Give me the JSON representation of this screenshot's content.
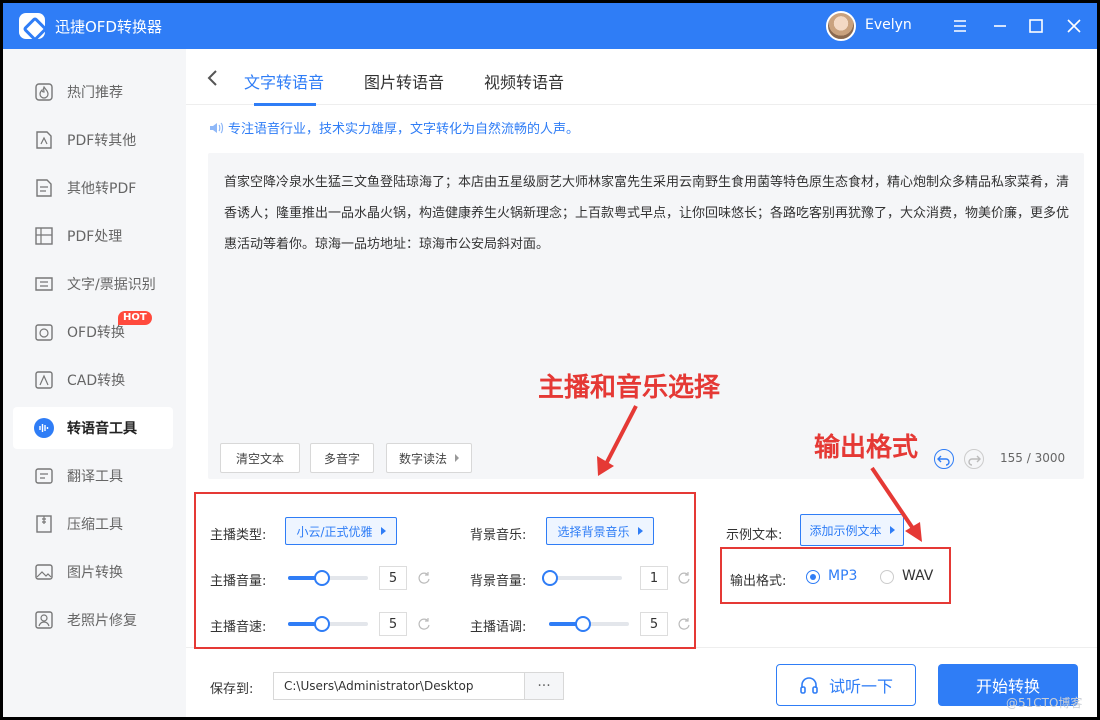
{
  "app": {
    "title": "迅捷OFD转换器",
    "username": "Evelyn"
  },
  "sidebar": {
    "items": [
      {
        "label": "热门推荐",
        "icon": "hot-recommend-icon"
      },
      {
        "label": "PDF转其他",
        "icon": "pdf-convert-icon"
      },
      {
        "label": "其他转PDF",
        "icon": "to-pdf-icon"
      },
      {
        "label": "PDF处理",
        "icon": "pdf-process-icon"
      },
      {
        "label": "文字/票据识别",
        "icon": "ocr-icon"
      },
      {
        "label": "OFD转换",
        "icon": "ofd-icon",
        "badge": "HOT"
      },
      {
        "label": "CAD转换",
        "icon": "cad-icon"
      },
      {
        "label": "转语音工具",
        "icon": "voice-icon",
        "active": true
      },
      {
        "label": "翻译工具",
        "icon": "translate-icon"
      },
      {
        "label": "压缩工具",
        "icon": "compress-icon"
      },
      {
        "label": "图片转换",
        "icon": "image-icon"
      },
      {
        "label": "老照片修复",
        "icon": "photo-restore-icon"
      }
    ]
  },
  "tabs": [
    "文字转语音",
    "图片转语音",
    "视频转语音"
  ],
  "notice": "专注语音行业，技术实力雄厚，文字转化为自然流畅的人声。",
  "textarea": {
    "content": "首家空降冷泉水生猛三文鱼登陆琼海了；本店由五星级厨艺大师林家富先生采用云南野生食用菌等特色原生态食材，精心炮制众多精品私家菜肴，清香诱人；隆重推出一品水晶火锅，构造健康养生火锅新理念；上百款粤式早点，让你回味悠长；各路吃客别再犹豫了，大众消费，物美价廉，更多优惠活动等着你。琼海一品坊地址：琼海市公安局斜对面。",
    "clear_label": "清空文本",
    "polyphone_label": "多音字",
    "number_label": "数字读法",
    "counter": "155 / 3000"
  },
  "annotations": {
    "anchor_music": "主播和音乐选择",
    "output_format": "输出格式"
  },
  "settings": {
    "anchor_type_label": "主播类型:",
    "anchor_type_value": "小云/正式优雅",
    "anchor_volume_label": "主播音量:",
    "anchor_volume": "5",
    "anchor_speed_label": "主播音速:",
    "anchor_speed": "5",
    "bg_music_label": "背景音乐:",
    "bg_music_value": "选择背景音乐",
    "bg_volume_label": "背景音量:",
    "bg_volume": "1",
    "anchor_pitch_label": "主播语调:",
    "anchor_pitch": "5",
    "sample_text_label": "示例文本:",
    "sample_text_value": "添加示例文本",
    "output_format_label": "输出格式:",
    "format_options": [
      "MP3",
      "WAV"
    ],
    "selected_format": "MP3"
  },
  "bottom": {
    "save_label": "保存到:",
    "path": "C:\\Users\\Administrator\\Desktop",
    "browse_label": "···",
    "listen_label": "试听一下",
    "start_label": "开始转换"
  },
  "watermark": "@51CTO博客",
  "colors": {
    "accent": "#2f7df6",
    "annotation": "#e53935"
  }
}
